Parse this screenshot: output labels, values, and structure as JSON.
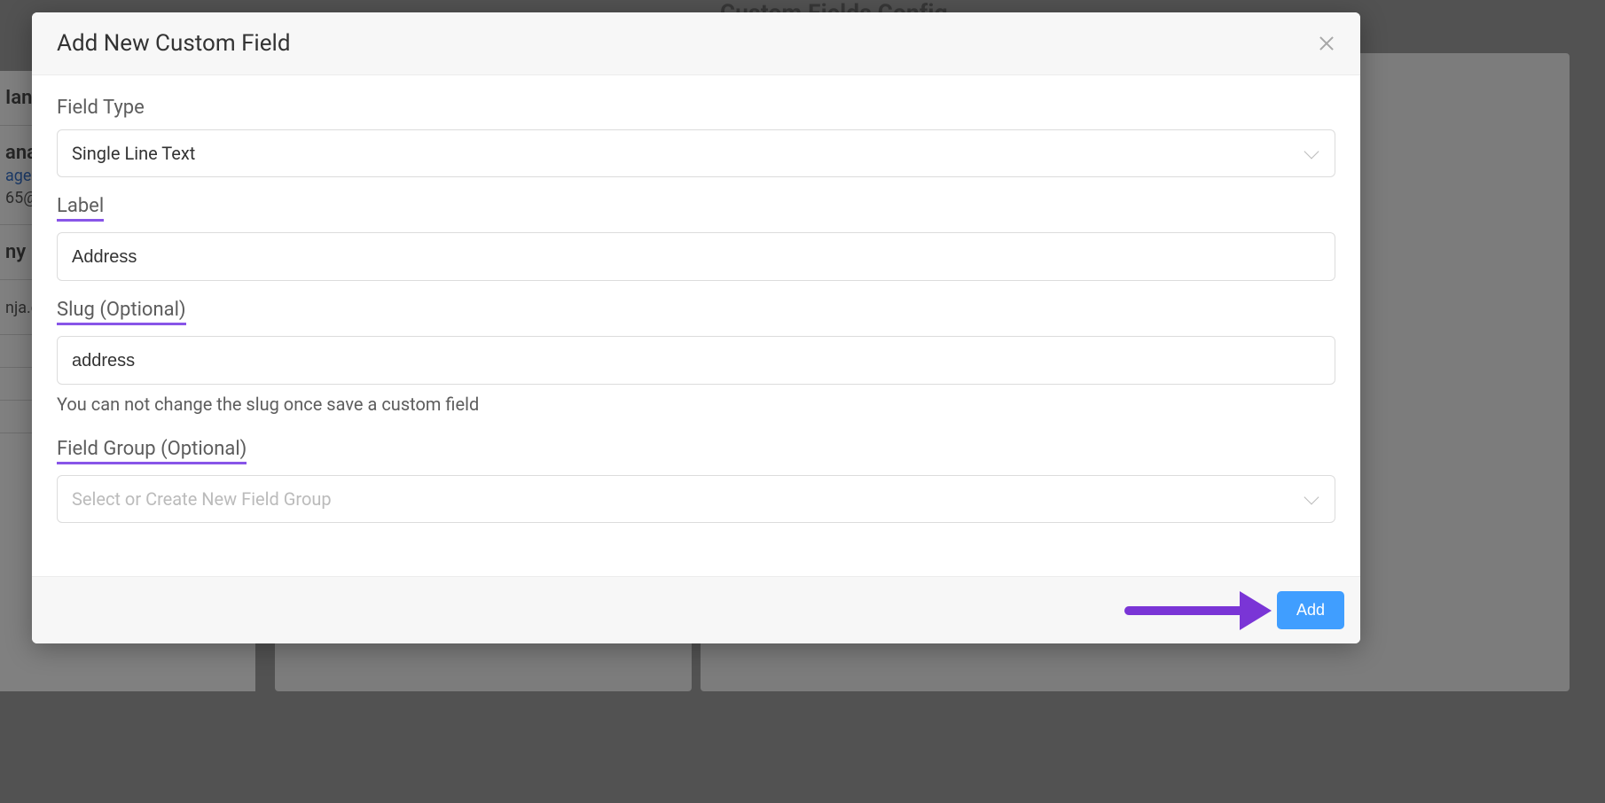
{
  "background": {
    "header": "Custom Fields Config",
    "left_panel": {
      "row1": "Iana",
      "row2a": "ana",
      "row2b": "agen",
      "row2c": "65@",
      "row3": "ny",
      "row4": "nja.c"
    }
  },
  "modal": {
    "title": "Add New Custom Field",
    "field_type": {
      "label": "Field Type",
      "value": "Single Line Text"
    },
    "label_field": {
      "label": "Label",
      "value": "Address"
    },
    "slug_field": {
      "label": "Slug (Optional)",
      "value": "address",
      "hint": "You can not change the slug once save a custom field"
    },
    "group_field": {
      "label": "Field Group (Optional)",
      "placeholder": "Select or Create New Field Group"
    },
    "add_button": "Add"
  }
}
